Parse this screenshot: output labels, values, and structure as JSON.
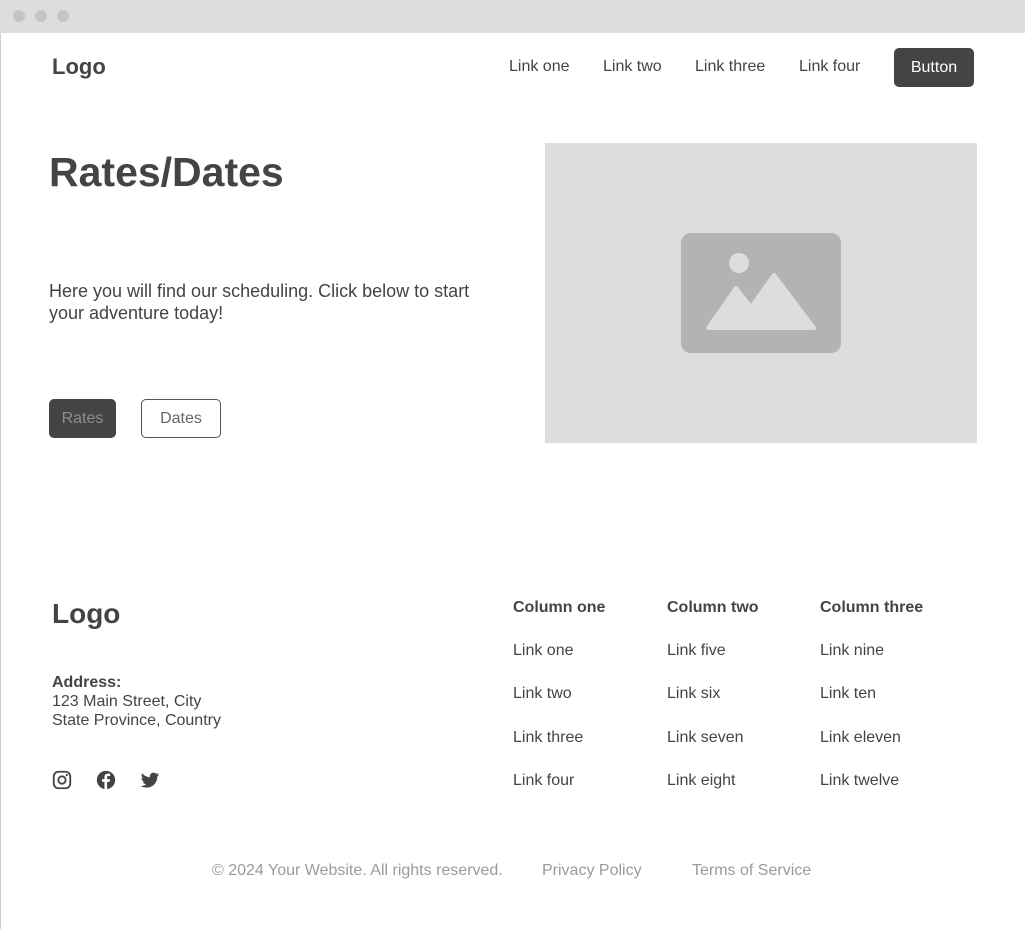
{
  "header": {
    "logo": "Logo",
    "nav": [
      "Link one",
      "Link two",
      "Link three",
      "Link four"
    ],
    "button": "Button"
  },
  "hero": {
    "title": "Rates/Dates",
    "text": "Here you will find our scheduling. Click below to start your adventure today!",
    "primary_button": "Rates",
    "secondary_button": "Dates",
    "image_icon": "image-placeholder-icon"
  },
  "footer": {
    "logo": "Logo",
    "address_label": "Address:",
    "address_line1": "123 Main Street, City",
    "address_line2": "State Province, Country",
    "social_icons": [
      "instagram-icon",
      "facebook-icon",
      "twitter-icon"
    ],
    "columns": [
      {
        "title": "Column one",
        "links": [
          "Link one",
          "Link two",
          "Link three",
          "Link four"
        ]
      },
      {
        "title": "Column two",
        "links": [
          "Link five",
          "Link six",
          "Link seven",
          "Link eight"
        ]
      },
      {
        "title": "Column three",
        "links": [
          "Link nine",
          "Link ten",
          "Link eleven",
          "Link twelve"
        ]
      }
    ],
    "copyright": "© 2024 Your Website. All rights reserved.",
    "privacy": "Privacy Policy",
    "terms": "Terms of Service"
  },
  "colors": {
    "dark": "#444444",
    "placeholder": "#dddddd",
    "placeholder_icon": "#b3b3b3",
    "muted_text": "#9a9a9a"
  }
}
